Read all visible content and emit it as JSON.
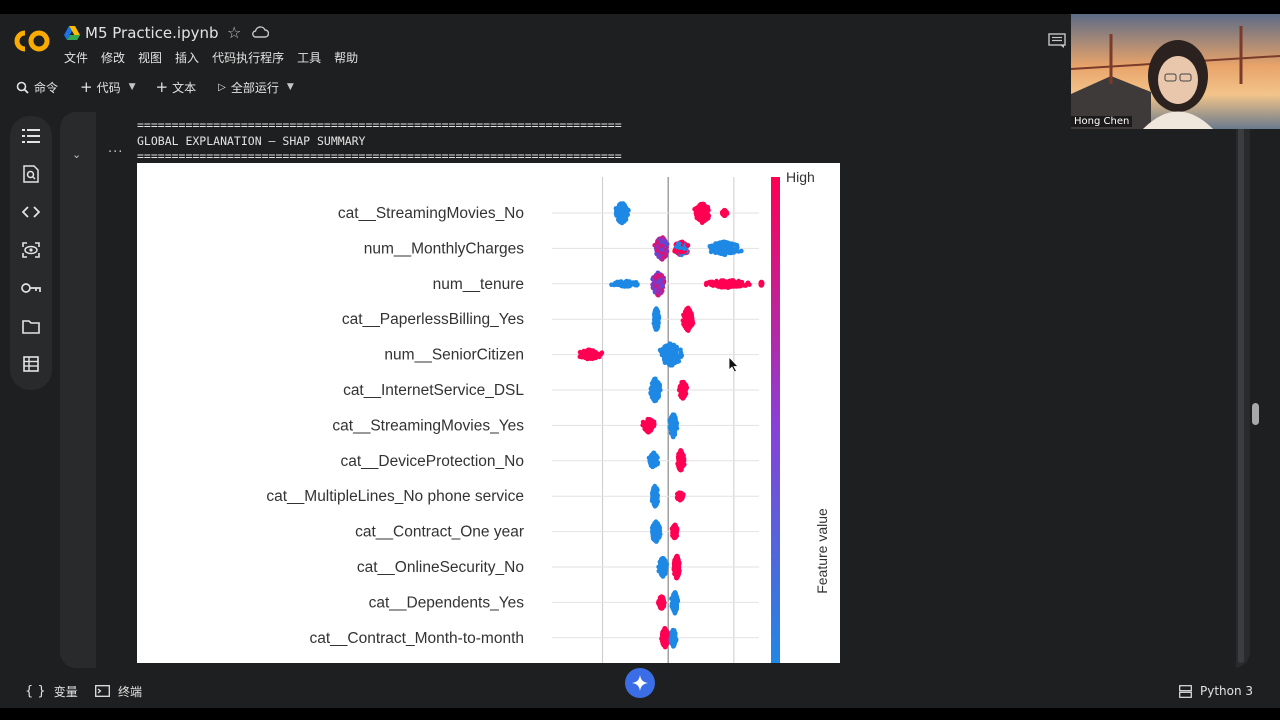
{
  "app": {
    "notebook_title": "M5 Practice.ipynb",
    "menu": [
      "文件",
      "修改",
      "视图",
      "插入",
      "代码执行程序",
      "工具",
      "帮助"
    ]
  },
  "toolbar": {
    "command_label": "命令",
    "code_label": "代码",
    "text_label": "文本",
    "run_all_label": "全部运行"
  },
  "output": {
    "separator": "======================================================================",
    "heading": "GLOBAL EXPLANATION – SHAP SUMMARY"
  },
  "colorbar": {
    "high_label": "High",
    "axis_label": "Feature value",
    "low_color": "#1e88e5",
    "high_color": "#ff0052"
  },
  "chart_data": {
    "type": "scatter",
    "subtype": "shap_beeswarm",
    "features": [
      "cat__StreamingMovies_No",
      "num__MonthlyCharges",
      "num__tenure",
      "cat__PaperlessBilling_Yes",
      "num__SeniorCitizen",
      "cat__InternetService_DSL",
      "cat__StreamingMovies_Yes",
      "cat__DeviceProtection_No",
      "cat__MultipleLines_No phone service",
      "cat__Contract_One year",
      "cat__OnlineSecurity_No",
      "cat__Dependents_Yes",
      "cat__Contract_Month-to-month"
    ],
    "clusters": [
      [
        {
          "center": -0.7,
          "spread": 0.12,
          "height": 11,
          "color": "low"
        },
        {
          "center": 0.52,
          "spread": 0.14,
          "height": 10,
          "color": "high"
        },
        {
          "center": 0.86,
          "spread": 0.05,
          "height": 3,
          "color": "high"
        }
      ],
      [
        {
          "center": -0.1,
          "spread": 0.12,
          "height": 12,
          "color": "mid"
        },
        {
          "center": 0.2,
          "spread": 0.15,
          "height": 7,
          "color": "mixedhigh"
        },
        {
          "center": 0.85,
          "spread": 0.3,
          "height": 7,
          "color": "low"
        }
      ],
      [
        {
          "center": -0.65,
          "spread": 0.25,
          "height": 3,
          "color": "low"
        },
        {
          "center": -0.15,
          "spread": 0.12,
          "height": 12,
          "color": "mid"
        },
        {
          "center": 0.9,
          "spread": 0.45,
          "height": 4,
          "color": "high"
        },
        {
          "center": 1.42,
          "spread": 0.02,
          "height": 2,
          "color": "high"
        }
      ],
      [
        {
          "center": -0.18,
          "spread": 0.05,
          "height": 12,
          "color": "low"
        },
        {
          "center": 0.3,
          "spread": 0.09,
          "height": 12,
          "color": "high"
        }
      ],
      [
        {
          "center": -1.2,
          "spread": 0.22,
          "height": 5,
          "color": "high"
        },
        {
          "center": 0.04,
          "spread": 0.2,
          "height": 12,
          "color": "low"
        }
      ],
      [
        {
          "center": -0.2,
          "spread": 0.09,
          "height": 12,
          "color": "low"
        },
        {
          "center": 0.22,
          "spread": 0.08,
          "height": 9,
          "color": "high"
        }
      ],
      [
        {
          "center": -0.3,
          "spread": 0.12,
          "height": 7,
          "color": "high"
        },
        {
          "center": 0.08,
          "spread": 0.07,
          "height": 12,
          "color": "low"
        }
      ],
      [
        {
          "center": -0.22,
          "spread": 0.08,
          "height": 8,
          "color": "low"
        },
        {
          "center": 0.19,
          "spread": 0.06,
          "height": 11,
          "color": "high"
        }
      ],
      [
        {
          "center": -0.2,
          "spread": 0.06,
          "height": 11,
          "color": "low"
        },
        {
          "center": 0.18,
          "spread": 0.07,
          "height": 4,
          "color": "high"
        }
      ],
      [
        {
          "center": -0.19,
          "spread": 0.08,
          "height": 11,
          "color": "low"
        },
        {
          "center": 0.1,
          "spread": 0.06,
          "height": 7,
          "color": "high"
        }
      ],
      [
        {
          "center": -0.08,
          "spread": 0.08,
          "height": 10,
          "color": "low"
        },
        {
          "center": 0.13,
          "spread": 0.06,
          "height": 12,
          "color": "high"
        }
      ],
      [
        {
          "center": -0.1,
          "spread": 0.06,
          "height": 7,
          "color": "high"
        },
        {
          "center": 0.1,
          "spread": 0.06,
          "height": 11,
          "color": "low"
        }
      ],
      [
        {
          "center": -0.05,
          "spread": 0.06,
          "height": 10,
          "color": "high"
        },
        {
          "center": 0.08,
          "spread": 0.05,
          "height": 9,
          "color": "low"
        }
      ]
    ],
    "xlim": [
      -1.45,
      1.55
    ],
    "xgrid": [
      -1.0,
      0.0,
      1.0
    ],
    "grid": true,
    "legend": "colorbar-right"
  },
  "bottom": {
    "variables_label": "变量",
    "terminal_label": "终端",
    "runtime_label": "Python 3"
  },
  "video": {
    "participant_name": "Hong Chen"
  }
}
